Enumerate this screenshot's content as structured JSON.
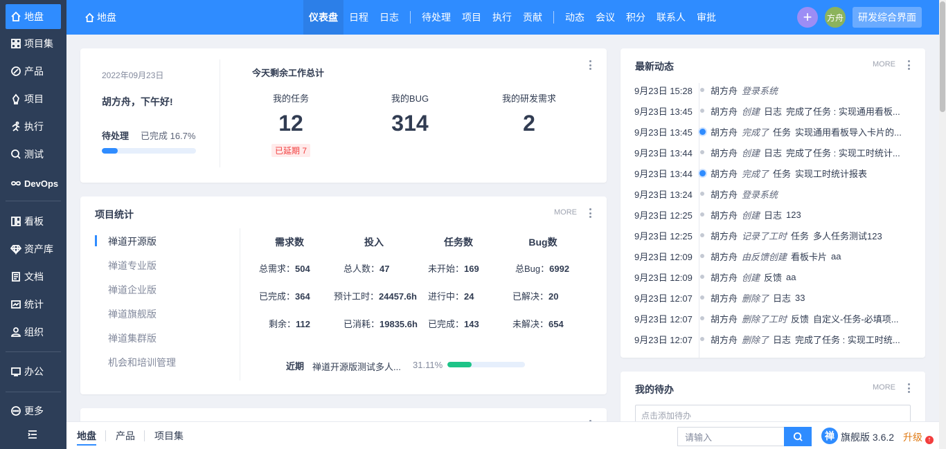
{
  "sidebar": {
    "items": [
      {
        "label": "地盘",
        "icon": "home-icon"
      },
      {
        "label": "项目集",
        "icon": "grid-icon"
      },
      {
        "label": "产品",
        "icon": "product-icon"
      },
      {
        "label": "项目",
        "icon": "project-icon"
      },
      {
        "label": "执行",
        "icon": "run-icon"
      },
      {
        "label": "测试",
        "icon": "test-icon"
      },
      {
        "label": "DevOps",
        "icon": "infinity-icon"
      },
      {
        "label": "看板",
        "icon": "kanban-icon"
      },
      {
        "label": "资产库",
        "icon": "diamond-icon"
      },
      {
        "label": "文档",
        "icon": "doc-icon"
      },
      {
        "label": "统计",
        "icon": "chart-icon"
      },
      {
        "label": "组织",
        "icon": "user-icon"
      },
      {
        "label": "办公",
        "icon": "oa-icon"
      },
      {
        "label": "更多",
        "icon": "more-icon"
      }
    ],
    "collapse_icon": "menu-collapse-icon"
  },
  "topbar": {
    "crumb": "地盘",
    "nav": [
      "仪表盘",
      "日程",
      "日志",
      "待处理",
      "项目",
      "执行",
      "贡献",
      "动态",
      "会议",
      "积分",
      "联系人",
      "审批"
    ],
    "avatar": "方舟",
    "rd_button": "研发综合界面"
  },
  "welcome": {
    "date": "2022年09月23日",
    "greeting": "胡方舟，下午好!",
    "pending_label": "待处理",
    "done_label": "已完成 16.7%",
    "progress": 16.7,
    "summary_title": "今天剩余工作总计",
    "stats": [
      {
        "label": "我的任务",
        "value": "12"
      },
      {
        "label": "我的BUG",
        "value": "314"
      },
      {
        "label": "我的研发需求",
        "value": "2"
      }
    ],
    "overdue": "已延期 7"
  },
  "project_stats": {
    "title": "项目统计",
    "more": "MORE",
    "projects": [
      "禅道开源版",
      "禅道专业版",
      "禅道企业版",
      "禅道旗舰版",
      "禅道集群版",
      "机会和培训管理"
    ],
    "headers": [
      "需求数",
      "投入",
      "任务数",
      "Bug数"
    ],
    "rows": [
      [
        {
          "k": "总需求：",
          "v": "504"
        },
        {
          "k": "总人数：",
          "v": "47"
        },
        {
          "k": "未开始：",
          "v": "169"
        },
        {
          "k": "总Bug：",
          "v": "6992"
        }
      ],
      [
        {
          "k": "已完成：",
          "v": "364"
        },
        {
          "k": "预计工时：",
          "v": "24457.6h"
        },
        {
          "k": "进行中：",
          "v": "24"
        },
        {
          "k": "已解决：",
          "v": "20"
        }
      ],
      [
        {
          "k": "剩余：",
          "v": "112"
        },
        {
          "k": "已消耗：",
          "v": "19835.6h"
        },
        {
          "k": "已完成：",
          "v": "143"
        },
        {
          "k": "未解决：",
          "v": "654"
        }
      ]
    ],
    "recent_label": "近期",
    "recent_name": "禅道开源版测试多人...",
    "recent_pct": "31.11%",
    "recent_progress": 31.11
  },
  "feed": {
    "title": "最新动态",
    "more": "MORE",
    "rows": [
      {
        "time": "9月23日 15:28",
        "who": "胡方舟",
        "act": "登录系统",
        "type": "",
        "obj": "",
        "hl": false
      },
      {
        "time": "9月23日 13:45",
        "who": "胡方舟",
        "act": "创建",
        "type": "日志",
        "obj": "完成了任务 : 实现通用看板...",
        "hl": false
      },
      {
        "time": "9月23日 13:45",
        "who": "胡方舟",
        "act": "完成了",
        "type": "任务",
        "obj": "实现通用看板导入卡片的...",
        "hl": true
      },
      {
        "time": "9月23日 13:44",
        "who": "胡方舟",
        "act": "创建",
        "type": "日志",
        "obj": "完成了任务 : 实现工时统计...",
        "hl": false
      },
      {
        "time": "9月23日 13:44",
        "who": "胡方舟",
        "act": "完成了",
        "type": "任务",
        "obj": "实现工时统计报表",
        "hl": true
      },
      {
        "time": "9月23日 13:24",
        "who": "胡方舟",
        "act": "登录系统",
        "type": "",
        "obj": "",
        "hl": false
      },
      {
        "time": "9月23日 12:25",
        "who": "胡方舟",
        "act": "创建",
        "type": "日志",
        "obj": "123",
        "hl": false
      },
      {
        "time": "9月23日 12:25",
        "who": "胡方舟",
        "act": "记录了工时",
        "type": "任务",
        "obj": "多人任务测试123",
        "hl": false
      },
      {
        "time": "9月23日 12:09",
        "who": "胡方舟",
        "act": "由反馈创建",
        "type": "看板卡片",
        "obj": "aa",
        "hl": false
      },
      {
        "time": "9月23日 12:09",
        "who": "胡方舟",
        "act": "创建",
        "type": "反馈",
        "obj": "aa",
        "hl": false
      },
      {
        "time": "9月23日 12:07",
        "who": "胡方舟",
        "act": "删除了",
        "type": "日志",
        "obj": "33",
        "hl": false
      },
      {
        "time": "9月23日 12:07",
        "who": "胡方舟",
        "act": "删除了工时",
        "type": "反馈",
        "obj": "自定义-任务-必填项...",
        "hl": false
      },
      {
        "time": "9月23日 12:07",
        "who": "胡方舟",
        "act": "删除了",
        "type": "日志",
        "obj": "完成了任务 : 实现工时统...",
        "hl": false
      }
    ]
  },
  "todo": {
    "title": "我的待办",
    "more": "MORE",
    "placeholder": "点击添加待办"
  },
  "bottom": {
    "tabs": [
      "地盘",
      "产品",
      "项目集"
    ],
    "search_placeholder": "请输入",
    "version": "旗舰版 3.6.2",
    "upgrade": "升级"
  }
}
